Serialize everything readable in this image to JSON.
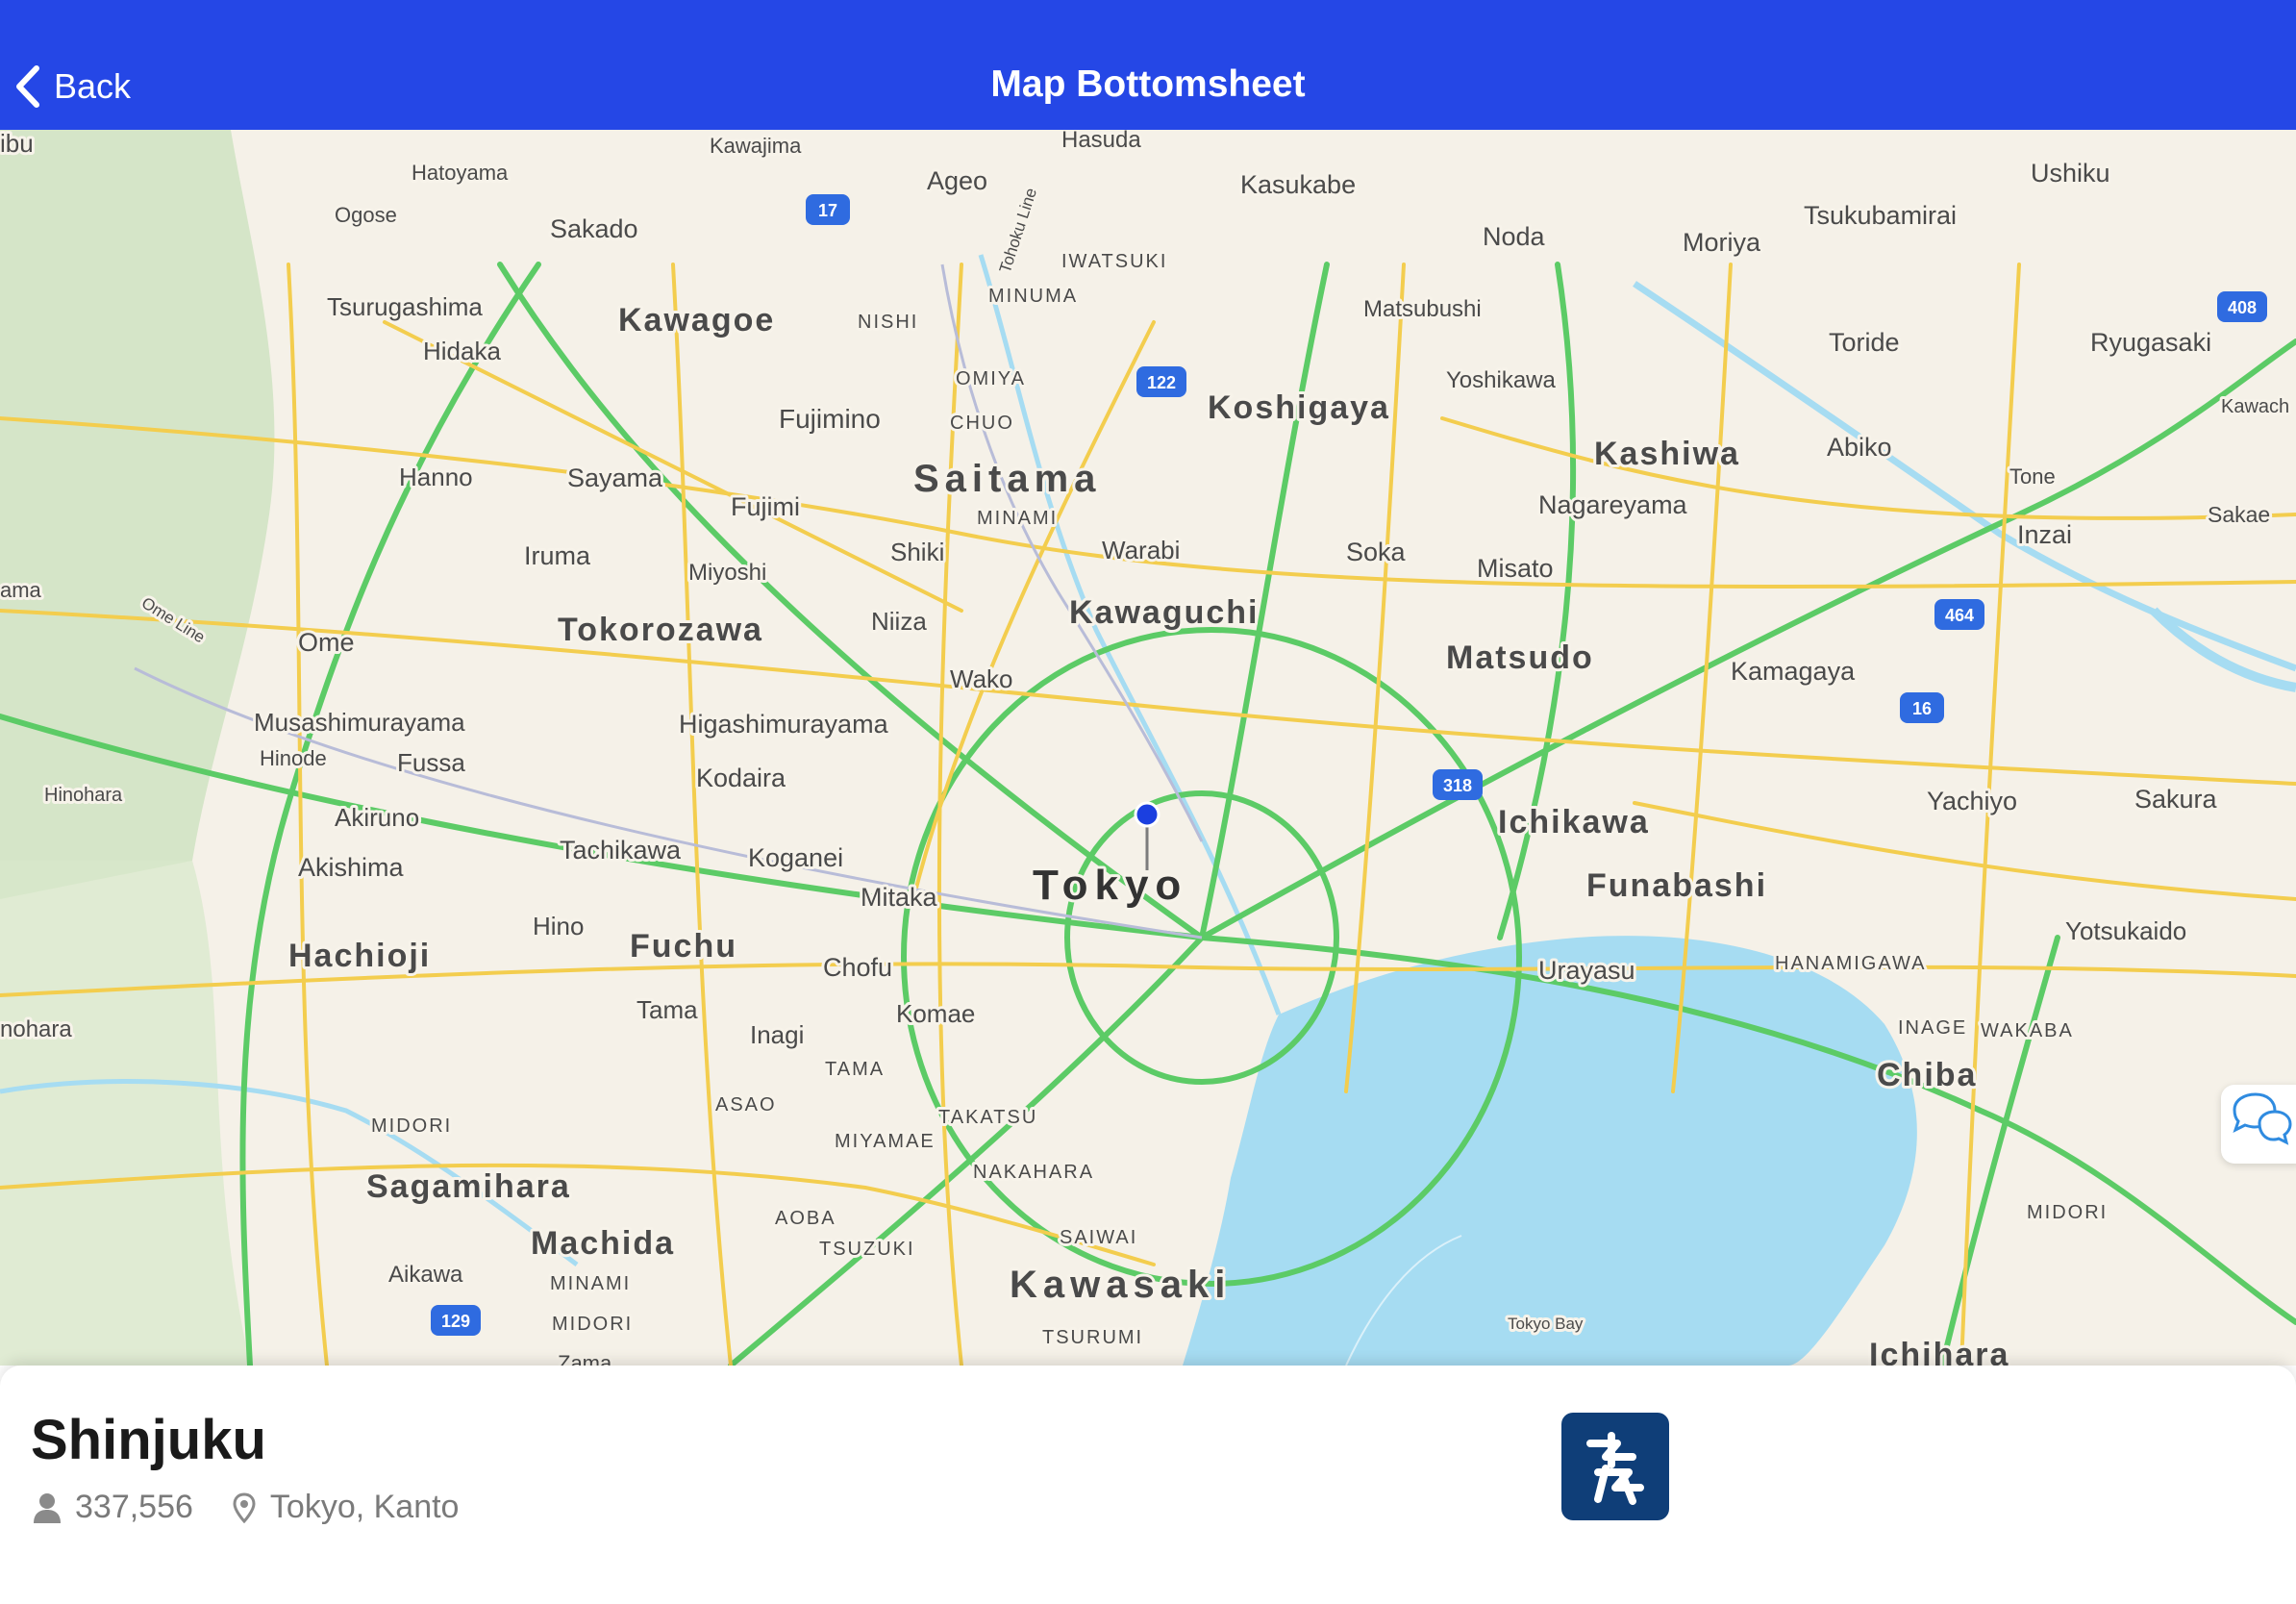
{
  "nav": {
    "back_label": "Back",
    "title": "Map Bottomsheet"
  },
  "icons": {
    "back": "chevron-left-icon",
    "pin": "map-pin-icon",
    "person": "person-icon",
    "location": "location-pin-icon",
    "logo": "place-logo-icon",
    "chat": "chat-bubbles-icon"
  },
  "colors": {
    "nav_bar": "#2547e6",
    "map_land": "#f5f1e8",
    "water": "#a6dcf2",
    "highway": "#5ccb66",
    "major_road": "#f3cd4e",
    "pin": "#1b3fe0",
    "logo_bg": "#0f3e78"
  },
  "map": {
    "cities": [
      "Saitama",
      "Tokyo",
      "Kawasaki",
      "Kawagoe",
      "Koshigaya",
      "Kashiwa",
      "Kawaguchi",
      "Matsudo",
      "Ichikawa",
      "Funabashi",
      "Chiba",
      "Tokorozawa",
      "Hachioji",
      "Fuchu",
      "Sagamihara",
      "Machida",
      "Ichihara",
      "Kasukabe",
      "Ageo",
      "Sakado",
      "Noda",
      "Moriya",
      "Tsukubamirai",
      "Ushiku",
      "Toride",
      "Ryugasaki",
      "Abiko",
      "Nagareyama",
      "Inzai",
      "Sakae",
      "Kamagaya",
      "Yachiyo",
      "Sakura",
      "Yotsukaido",
      "Urayasu",
      "Misato",
      "Soka",
      "Warabi",
      "Shiki",
      "Niiza",
      "Wako",
      "Fujimi",
      "Fujimino",
      "Sayama",
      "Iruma",
      "Hanno",
      "Hidaka",
      "Tsurugashima",
      "Ome",
      "Musashimurayama",
      "Higashimurayama",
      "Kodaira",
      "Koganei",
      "Mitaka",
      "Chofu",
      "Komae",
      "Inagi",
      "Tama",
      "Hino",
      "Tachikawa",
      "Akishima",
      "Akiruno",
      "Fussa",
      "Miyoshi",
      "Yoshikawa",
      "Matsubushi",
      "Kawajima",
      "Hatoyama",
      "Ogose",
      "Hasuda",
      "Hinode",
      "Hinohara",
      "Aikawa",
      "Tone",
      "Kawach",
      "Zama"
    ],
    "districts": [
      "IWATSUKI",
      "MINUMA",
      "NISHI",
      "OMIYA",
      "CHUO",
      "MINAMI",
      "HANAMIGAWA",
      "INAGE",
      "WAKABA",
      "MIDORI",
      "TAMA",
      "ASAO",
      "TAKATSU",
      "MIYAMAE",
      "NAKAHARA",
      "AOBA",
      "TSUZUKI",
      "SAIWAI",
      "TSURUMI"
    ],
    "water_label": "Tokyo Bay",
    "rail_labels": [
      "Tohoku Line",
      "Ome Line"
    ],
    "route_shields": [
      "17",
      "122",
      "408",
      "464",
      "16",
      "318",
      "129"
    ],
    "edge_labels": [
      "ibu",
      "ama",
      "nohara"
    ]
  },
  "sheet": {
    "name": "Shinjuku",
    "population": "337,556",
    "location": "Tokyo, Kanto"
  }
}
